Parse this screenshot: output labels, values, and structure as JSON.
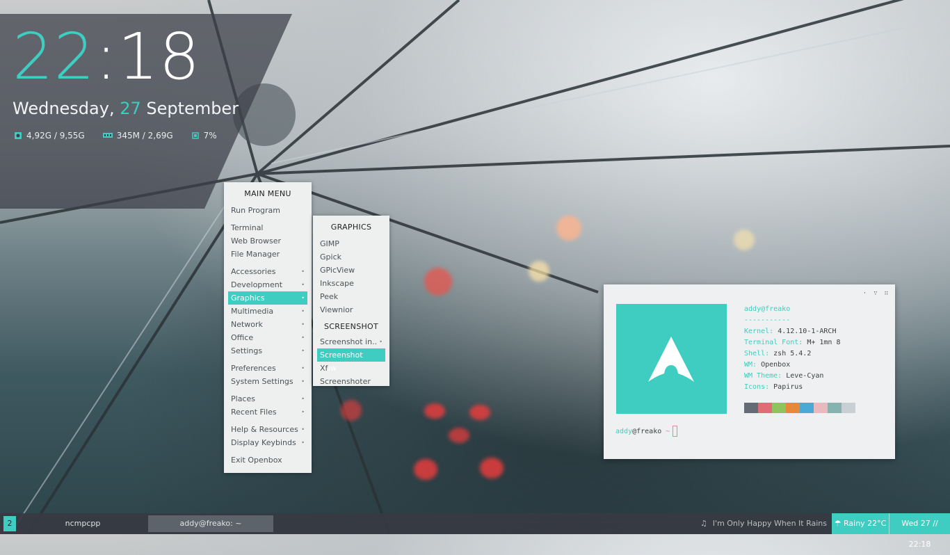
{
  "clock": {
    "hour": "22",
    "minute_sep": ":18",
    "weekday": "Wednesday,",
    "day": "27",
    "month": "September"
  },
  "stats": {
    "disk": "4,92G / 9,55G",
    "memory": "345M / 2,69G",
    "cpu": "7%"
  },
  "main_menu": {
    "title": "MAIN MENU",
    "items": [
      {
        "label": "Run Program"
      },
      {
        "label": "Terminal"
      },
      {
        "label": "Web Browser"
      },
      {
        "label": "File Manager"
      },
      {
        "label": "Accessories"
      },
      {
        "label": "Development"
      },
      {
        "label": "Graphics"
      },
      {
        "label": "Multimedia"
      },
      {
        "label": "Network"
      },
      {
        "label": "Office"
      },
      {
        "label": "Settings"
      },
      {
        "label": "Preferences"
      },
      {
        "label": "System Settings"
      },
      {
        "label": "Places"
      },
      {
        "label": "Recent Files"
      },
      {
        "label": "Help & Resources"
      },
      {
        "label": "Display Keybinds"
      },
      {
        "label": "Exit Openbox"
      }
    ]
  },
  "graphics_menu": {
    "title": "GRAPHICS",
    "items": [
      {
        "label": "GIMP"
      },
      {
        "label": "Gpick"
      },
      {
        "label": "GPicView"
      },
      {
        "label": "Inkscape"
      },
      {
        "label": "Peek"
      },
      {
        "label": "Viewnior"
      }
    ],
    "screenshot_title": "SCREENSHOT",
    "screenshot_items": [
      {
        "label": "Screenshot in.."
      },
      {
        "label": "Screenshot Now"
      },
      {
        "label": "Xf Screenshoter"
      }
    ]
  },
  "terminal": {
    "user_host": "addy@freako",
    "dashes": "-----------",
    "fields": [
      {
        "key": "Kernel:",
        "value": "4.12.10-1-ARCH"
      },
      {
        "key": "Terminal Font:",
        "value": "M+ 1mn 8"
      },
      {
        "key": "Shell:",
        "value": "zsh 5.4.2"
      },
      {
        "key": "WM:",
        "value": "Openbox"
      },
      {
        "key": "WM Theme:",
        "value": "Leve-Cyan"
      },
      {
        "key": "Icons:",
        "value": "Papirus"
      }
    ],
    "swatches": [
      "#656b75",
      "#e06c75",
      "#8fc35e",
      "#e6893a",
      "#4aa9d6",
      "#e8b9bd",
      "#86b3b0",
      "#c9d0d3"
    ],
    "prompt_user": "addy",
    "prompt_host": "@freako",
    "prompt_dir": "~",
    "title_buttons": [
      "·",
      "∵",
      "∷"
    ]
  },
  "taskbar": {
    "workspace": "2",
    "tasks": [
      {
        "label": "ncmpcpp"
      },
      {
        "label": "addy@freako: ~"
      }
    ],
    "now_playing": "I'm Only Happy When It Rains",
    "weather": "Rainy 22°C",
    "datetime": "Wed 27 // 22:18"
  },
  "colors": {
    "accent": "#3ecdc0"
  }
}
